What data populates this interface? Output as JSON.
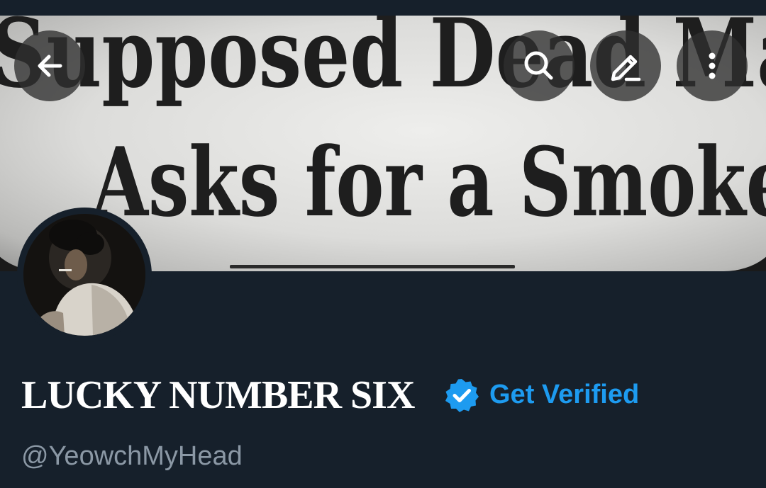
{
  "banner": {
    "headline_line1": "Supposed Dead Man",
    "headline_line2": "Asks for a Smoke"
  },
  "toolbar": {
    "back_icon": "arrow-left-icon",
    "search_icon": "search-icon",
    "edit_icon": "pencil-icon",
    "more_icon": "vertical-ellipsis-icon"
  },
  "profile": {
    "display_name": "LUCKY NUMBER SIX",
    "verified_icon": "verified-badge-icon",
    "get_verified_label": "Get Verified",
    "handle": "@YeowchMyHead"
  },
  "colors": {
    "background": "#16202b",
    "accent": "#1d9bf0",
    "secondary_text": "#8b98a5",
    "primary_text": "#ffffff"
  }
}
